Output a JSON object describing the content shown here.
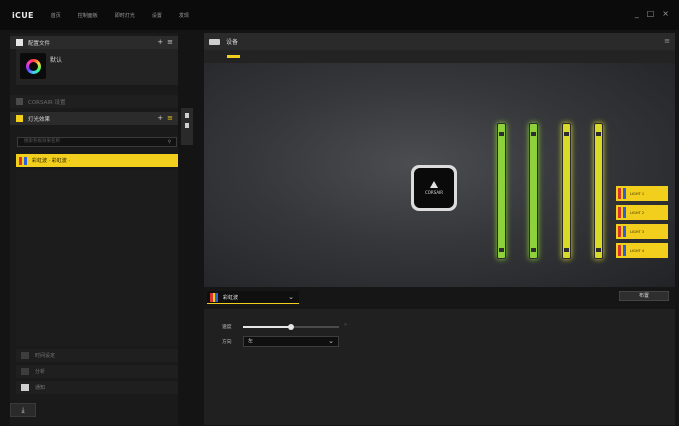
{
  "app": {
    "brand": "iCUE"
  },
  "nav": [
    "首页",
    "控制面板",
    "即时灯光",
    "设置",
    "发现"
  ],
  "window_controls": [
    "_",
    "□",
    "×"
  ],
  "left": {
    "profiles_header": "配置文件",
    "profile_name": "默认",
    "section_label": "CORSAIR 设置",
    "lighting_header": "灯光效果",
    "search_placeholder": "搜索各板效果名称",
    "selected_effect": "彩虹波 · 彩虹波 ·",
    "bottom_items": [
      "时间设定",
      "分析",
      "通知"
    ],
    "add_glyph": "+",
    "menu_glyph": "≡"
  },
  "right": {
    "device_header": "设备",
    "cooler_brand": "CORSAIR",
    "led_labels": [
      "LIGHT 1",
      "LIGHT 2",
      "LIGHT 3",
      "LIGHT 4"
    ],
    "effect_select": "彩虹波",
    "settings_button": "布置",
    "speed_label": "速度",
    "direction_label": "方向",
    "direction_value": "左"
  },
  "colors": {
    "accent": "#f2cf1c",
    "ram_green": "#8fd13a",
    "ram_yellow": "#d9d92a"
  },
  "ram_sticks": [
    {
      "color": "green"
    },
    {
      "color": "green"
    },
    {
      "color": "yellow"
    },
    {
      "color": "yellow"
    }
  ],
  "speed_level": 0.5
}
